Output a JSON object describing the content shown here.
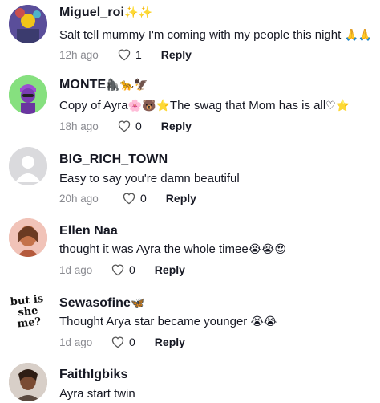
{
  "comments": [
    {
      "username": "Miguel_roi",
      "user_suffix": "✨✨",
      "text": "Salt tell mummy I'm coming with my people this night",
      "text_suffix": "🙏🙏",
      "time": "12h ago",
      "likes": "1",
      "reply": "Reply"
    },
    {
      "username": "MONTE",
      "user_suffix": "🦍🐆🦅",
      "text_prefix": "Copy of Ayra",
      "text_emojis": "🌸🐻⭐",
      "text": "The swag that Mom has is all",
      "text_suffix": "♡⭐",
      "time": "18h ago",
      "likes": "0",
      "reply": "Reply"
    },
    {
      "username": "BIG_RICH_TOWN",
      "text": "Easy to say you're damn beautiful",
      "time": "20h ago",
      "likes": "0",
      "reply": "Reply"
    },
    {
      "username": "Ellen Naa",
      "text": "thought it was Ayra the whole timee",
      "text_suffix": "😭😭😍",
      "time": "1d ago",
      "likes": "0",
      "reply": "Reply"
    },
    {
      "username": "Sewasofine",
      "user_suffix": "🦋",
      "text": "Thought Arya star became younger",
      "text_suffix": "😭😭",
      "time": "1d ago",
      "likes": "0",
      "reply": "Reply",
      "avatar_text": "but is she me?"
    },
    {
      "username": "FaithIgbiks",
      "text": "Ayra start twin"
    }
  ]
}
